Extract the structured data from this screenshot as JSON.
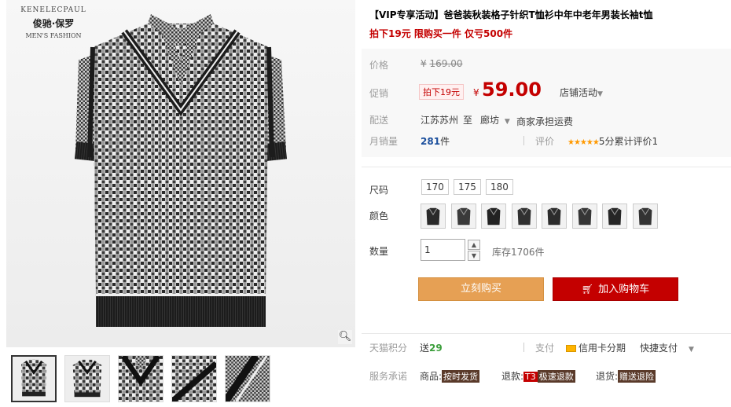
{
  "gallery": {
    "brand_arc": "KENELECPAUL",
    "brand_cn": "俊驰·保罗",
    "brand_en": "MEN'S FASHION",
    "zoom_icon": "magnifier-icon",
    "thumbnails": [
      "thumb-front",
      "thumb-front-alt",
      "thumb-collar",
      "thumb-fabric",
      "thumb-fabric-detail"
    ]
  },
  "product": {
    "title": "【VIP专享活动】爸爸装秋装格子针织T恤衫中年中老年男装长袖t恤",
    "subtitle": "拍下19元 限购买一件 仅亏500件"
  },
  "price": {
    "label": "价格",
    "currency": "¥",
    "original": "169.00",
    "promo_label": "促销",
    "promo_tag": "拍下19元",
    "current": "59.00",
    "shop_activity": "店铺活动"
  },
  "shipping": {
    "label": "配送",
    "from": "江苏苏州",
    "to_word": "至",
    "to": "廊坊",
    "fee_note": "商家承担运费"
  },
  "sales": {
    "label": "月销量",
    "count": "281",
    "unit": "件",
    "review_label": "评价",
    "stars": "★★★★★",
    "rating_text": "5分累计评价1"
  },
  "options": {
    "size_label": "尺码",
    "sizes": [
      "170",
      "175",
      "180"
    ],
    "color_label": "颜色",
    "colors": [
      "#2a2a2a",
      "#3a3a3a",
      "#222222",
      "#303030",
      "#2c2c2c",
      "#353535",
      "#262626",
      "#333333"
    ],
    "qty_label": "数量",
    "qty_value": "1",
    "stock": "库存1706件"
  },
  "actions": {
    "buy_now": "立刻购买",
    "add_cart": "加入购物车",
    "cart_icon": "cart-icon"
  },
  "footer": {
    "points_label": "天猫积分",
    "points_prefix": "送",
    "points_value": "29",
    "pay_label": "支付",
    "credit_card": "信用卡分期",
    "quick_pay": "快捷支付",
    "service_label": "服务承诺",
    "goods_label": "商品:",
    "goods_badge": "按时发货",
    "refund_label": "退款:",
    "refund_badge_red": "T3",
    "refund_badge": "极速退款",
    "return_label": "退货:",
    "return_badge": "赠送退险"
  },
  "colors": {
    "accent_red": "#c40000",
    "buy_orange": "#e6a054",
    "star_orange": "#ff9900",
    "link_blue": "#1a4e9c",
    "points_green": "#3b9e3b"
  }
}
